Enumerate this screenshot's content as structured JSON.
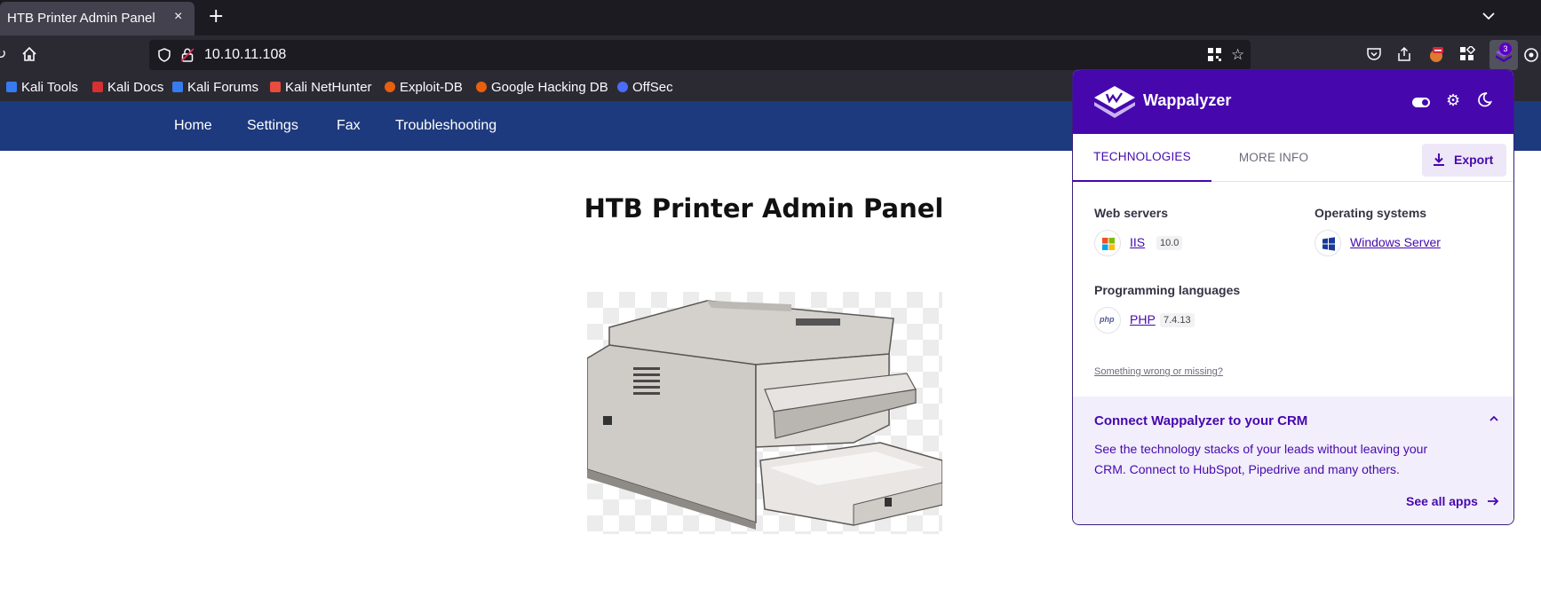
{
  "browser": {
    "tab_title": "HTB Printer Admin Panel",
    "tab_close": "×",
    "new_tab": "+",
    "url": "10.10.11.108",
    "extension_badge": "3"
  },
  "bookmarks": [
    {
      "label": "Kali Tools",
      "color": "#367bf0"
    },
    {
      "label": "Kali Docs",
      "color": "#d63031"
    },
    {
      "label": "Kali Forums",
      "color": "#367bf0"
    },
    {
      "label": "Kali NetHunter",
      "color": "#e74c3c"
    },
    {
      "label": "Exploit-DB",
      "color": "#e8600c"
    },
    {
      "label": "Google Hacking DB",
      "color": "#e8600c"
    },
    {
      "label": "OffSec",
      "color": "#4a6cf7"
    }
  ],
  "site": {
    "nav": [
      "Home",
      "Settings",
      "Fax",
      "Troubleshooting"
    ],
    "title": "HTB Printer Admin Panel"
  },
  "wappalyzer": {
    "name": "Wappalyzer",
    "tabs": {
      "technologies": "TECHNOLOGIES",
      "more_info": "MORE INFO"
    },
    "export_label": "Export",
    "categories": {
      "web_servers": "Web servers",
      "operating_systems": "Operating systems",
      "programming_languages": "Programming languages"
    },
    "technologies": {
      "iis": {
        "name": "IIS",
        "version": "10.0"
      },
      "windows": {
        "name": "Windows Server"
      },
      "php": {
        "name": "PHP",
        "version": "7.4.13",
        "icon_text": "php"
      }
    },
    "wrong_link": "Something wrong or missing?",
    "crm": {
      "title": "Connect Wappalyzer to your CRM",
      "body": "See the technology stacks of your leads without leaving your CRM. Connect to HubSpot, Pipedrive and many others.",
      "link": "See all apps"
    },
    "colors": {
      "brand": "#4608ad",
      "crm_bg": "#f2eefb"
    }
  }
}
